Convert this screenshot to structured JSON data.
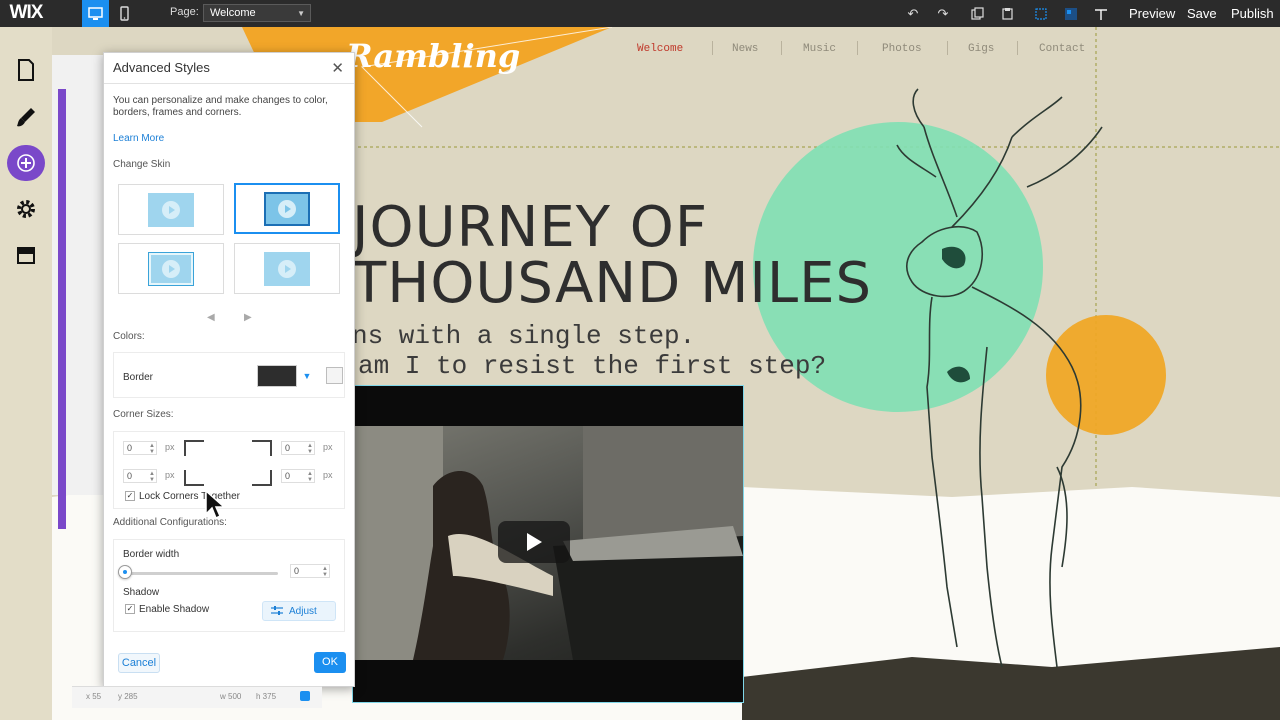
{
  "topbar": {
    "logo": "WIX",
    "page_label": "Page:",
    "page_select": "Welcome",
    "preview": "Preview",
    "save": "Save",
    "publish": "Publish"
  },
  "site": {
    "brand": "Rambling",
    "nav": [
      "Welcome",
      "News",
      "Music",
      "Photos",
      "Gigs",
      "Contact"
    ],
    "headline_line1": "JOURNEY OF",
    "headline_line2": "THOUSAND MILES",
    "tagline_line1": "ns with a single step.",
    "tagline_line2": "am I to resist the first step?"
  },
  "dialog": {
    "title": "Advanced Styles",
    "intro": "You can personalize and make changes to color, borders, frames and corners.",
    "learn_more": "Learn More",
    "change_skin": "Change Skin",
    "colors_label": "Colors:",
    "border_label": "Border",
    "border_color": "#2d2d2d",
    "corner_sizes_label": "Corner Sizes:",
    "corner_values": [
      "0",
      "0",
      "0",
      "0"
    ],
    "px_unit": "px",
    "lock_corners": "Lock Corners Together",
    "additional_label": "Additional Configurations:",
    "border_width_label": "Border width",
    "border_width_value": "0",
    "shadow_label": "Shadow",
    "enable_shadow": "Enable Shadow",
    "adjust": "Adjust",
    "cancel": "Cancel",
    "ok": "OK"
  },
  "statusbar": {
    "x": "x 55",
    "y": "y 285",
    "w": "w 500",
    "h": "h 375"
  },
  "colors": {
    "accent": "#1b8ff0",
    "add_button": "#7a48c9",
    "topbar": "#2b2b2b",
    "mint_circle": "#7fe0b4",
    "orange_circle": "#f0a623"
  }
}
